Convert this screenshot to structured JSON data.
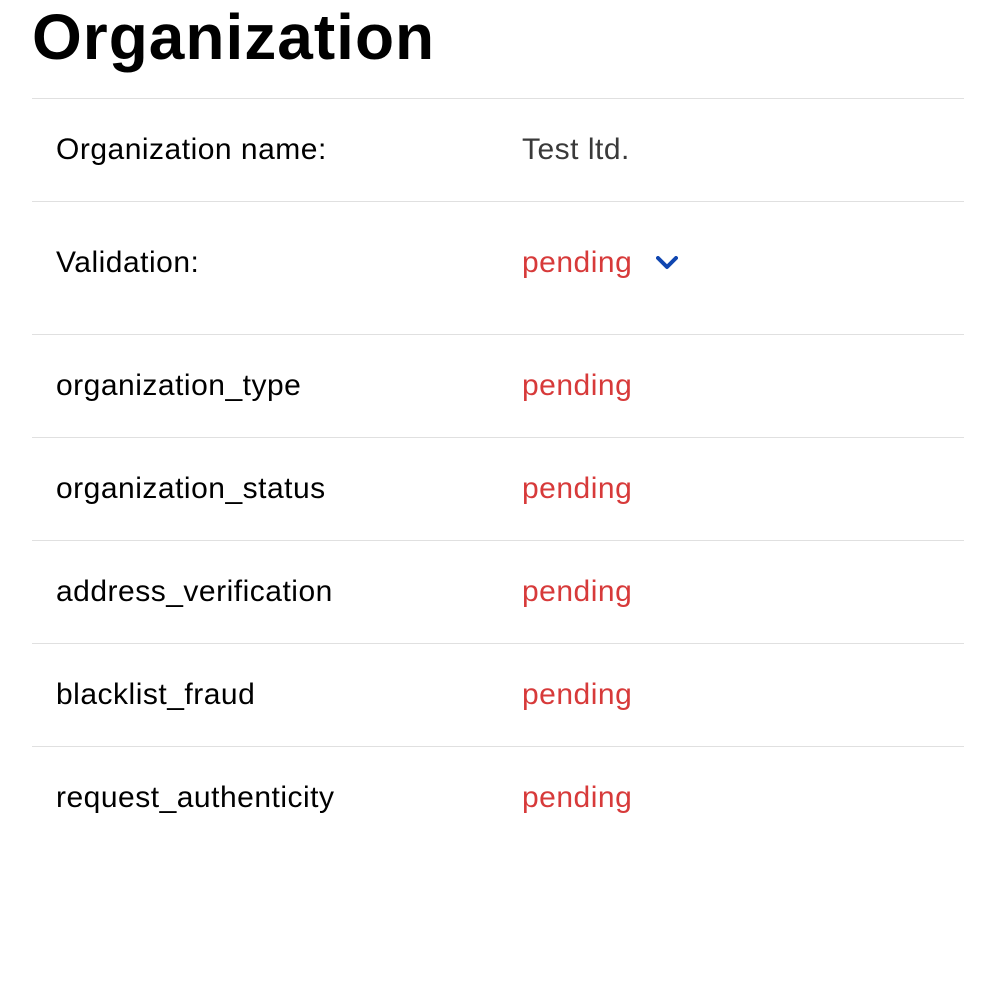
{
  "title": "Organization",
  "fields": {
    "org_name_label": "Organization name:",
    "org_name_value": "Test ltd.",
    "validation_label": "Validation:",
    "validation_value": "pending",
    "org_type_label": "organization_type",
    "org_type_value": "pending",
    "org_status_label": "organization_status",
    "org_status_value": "pending",
    "address_verification_label": "address_verification",
    "address_verification_value": "pending",
    "blacklist_fraud_label": "blacklist_fraud",
    "blacklist_fraud_value": "pending",
    "request_authenticity_label": "request_authenticity",
    "request_authenticity_value": "pending"
  },
  "colors": {
    "pending": "#d73a3a",
    "chevron": "#1046b0"
  }
}
